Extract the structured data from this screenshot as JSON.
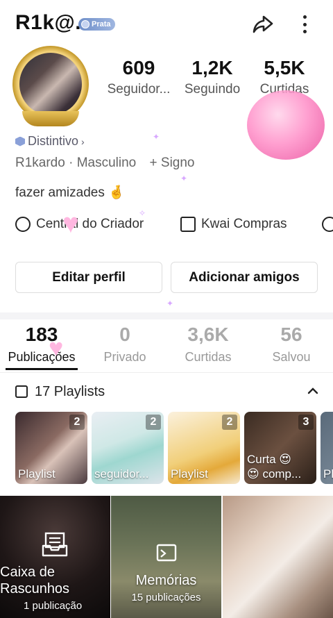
{
  "header": {
    "username": "R1k@.",
    "level_badge": "Prata"
  },
  "stats": {
    "seguidores": {
      "value": "609",
      "label": "Seguidor..."
    },
    "seguindo": {
      "value": "1,2K",
      "label": "Seguindo"
    },
    "curtidas": {
      "value": "5,5K",
      "label": "Curtidas"
    }
  },
  "profile": {
    "distintivo": "Distintivo",
    "info": "R1kardo · Masculino",
    "signo": "+ Signo",
    "bio": "fazer amizades 🤞"
  },
  "tools": {
    "creator_center": "Central do Criador",
    "kwai_compras": "Kwai Compras"
  },
  "buttons": {
    "edit_profile": "Editar perfil",
    "add_friends": "Adicionar amigos"
  },
  "tabs": [
    {
      "value": "183",
      "label": "Publicações"
    },
    {
      "value": "0",
      "label": "Privado"
    },
    {
      "value": "3,6K",
      "label": "Curtidas"
    },
    {
      "value": "56",
      "label": "Salvou"
    }
  ],
  "playlists": {
    "header": "17 Playlists",
    "items": [
      {
        "title": "Playlist",
        "count": "2"
      },
      {
        "title": "seguidor...",
        "count": "2"
      },
      {
        "title": "Playlist",
        "count": "2"
      },
      {
        "title": "Curta 😍\n😍 comp...",
        "count": "3"
      },
      {
        "title": "Pl",
        "count": ""
      }
    ]
  },
  "grid": {
    "drafts": {
      "title": "Caixa de Rascunhos",
      "sub": "1 publicação"
    },
    "memories": {
      "title": "Memórias",
      "sub": "15 publicações"
    }
  },
  "colors": {
    "accent": "#111111",
    "badge": "#6f8fc9",
    "gold": "#e8c25a"
  }
}
